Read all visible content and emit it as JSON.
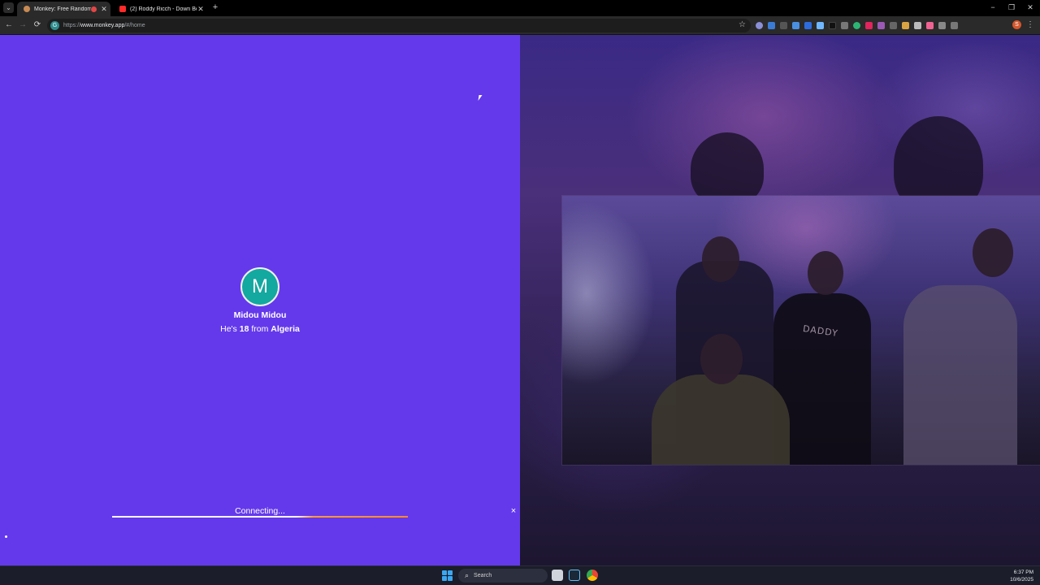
{
  "browser": {
    "tabs": [
      {
        "title": "Monkey: Free Random Video",
        "active": true,
        "favicon": "monkey-favicon-icon",
        "has_media_indicator": true
      },
      {
        "title": "(2) Roddy Ricch - Down Below",
        "active": false,
        "favicon": "youtube-icon"
      }
    ],
    "new_tab_label": "+",
    "window_controls": {
      "minimize": "−",
      "maximize": "❐",
      "close": "✕"
    },
    "nav": {
      "back": "←",
      "forward": "→",
      "reload": "⟳"
    },
    "address": {
      "scheme": "https://",
      "host": "www.monkey.app",
      "path": "/#/home"
    },
    "site_badge": "G",
    "profile_initial": "S"
  },
  "match": {
    "avatar_letter": "M",
    "name": "Midou Midou",
    "info_prefix": "He's ",
    "age": "18",
    "info_mid": " from ",
    "country": "Algeria"
  },
  "connection": {
    "status": "Connecting...",
    "progress": 1.0,
    "close_label": "×"
  },
  "video": {
    "shirt_text": "DADDY"
  },
  "taskbar": {
    "search_label": "Search",
    "time": "6:37 PM",
    "date": "10/6/2025"
  },
  "colors": {
    "left_pane_bg": "#6439ec",
    "avatar_bg": "#13a8a0",
    "progress_accent": "#ff8a2b"
  }
}
